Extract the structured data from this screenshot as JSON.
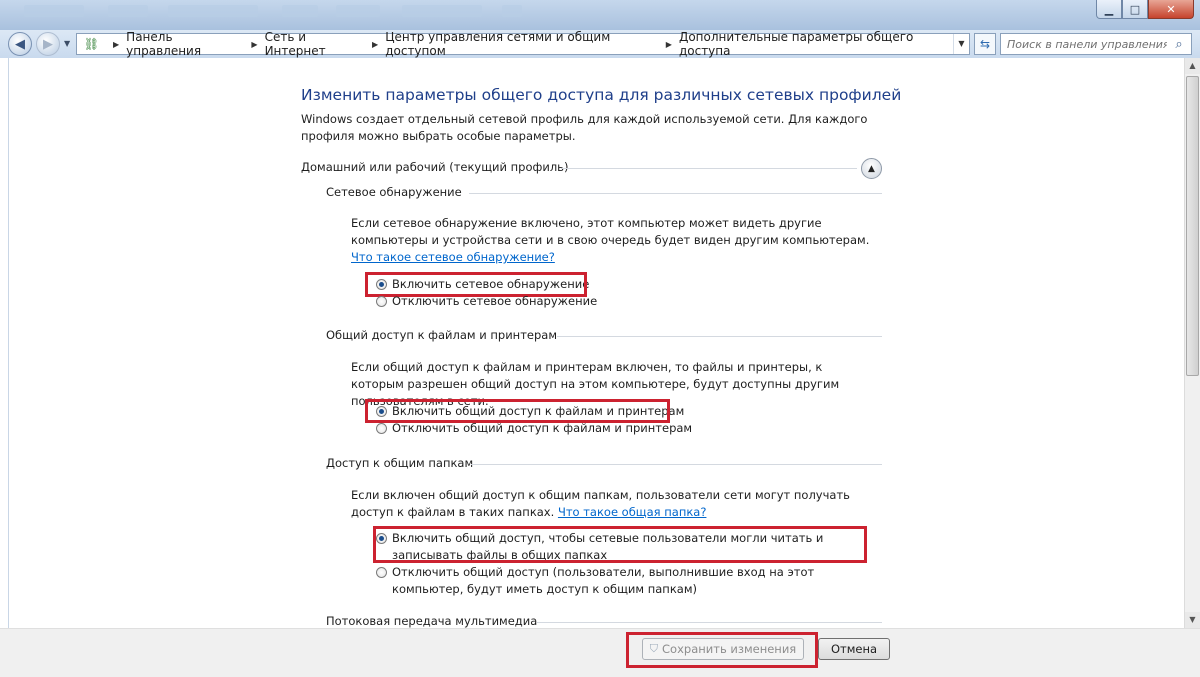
{
  "address_bar": {
    "breadcrumbs": [
      "Панель управления",
      "Сеть и Интернет",
      "Центр управления сетями и общим доступом",
      "Дополнительные параметры общего доступа"
    ],
    "search_placeholder": "Поиск в панели управления"
  },
  "main": {
    "title": "Изменить параметры общего доступа для различных сетевых профилей",
    "intro": "Windows создает отдельный сетевой профиль для каждой используемой сети. Для каждого профиля можно выбрать особые параметры.",
    "profile_header": "Домашний или рабочий (текущий профиль)",
    "sections": [
      {
        "title": "Сетевое обнаружение",
        "description": "Если сетевое обнаружение включено, этот компьютер может видеть другие компьютеры и устройства сети и в свою очередь будет виден другим компьютерам.",
        "link": "Что такое сетевое обнаружение?",
        "options": [
          {
            "label": "Включить сетевое обнаружение",
            "selected": true
          },
          {
            "label": "Отключить сетевое обнаружение",
            "selected": false
          }
        ]
      },
      {
        "title": "Общий доступ к файлам и принтерам",
        "description": "Если общий доступ к файлам и принтерам включен, то файлы и принтеры, к которым разрешен общий доступ на этом компьютере, будут доступны другим пользователям в сети.",
        "options": [
          {
            "label": "Включить общий доступ к файлам и принтерам",
            "selected": true
          },
          {
            "label": "Отключить общий доступ к файлам и принтерам",
            "selected": false
          }
        ]
      },
      {
        "title": "Доступ к общим папкам",
        "description": "Если включен общий доступ к общим папкам, пользователи сети могут получать доступ к файлам в таких папках.",
        "link": "Что такое общая папка?",
        "options": [
          {
            "label": "Включить общий доступ, чтобы сетевые пользователи могли читать и записывать файлы в общих папках",
            "selected": true
          },
          {
            "label": "Отключить общий доступ (пользователи, выполнившие вход на этот компьютер, будут иметь доступ к общим папкам)",
            "selected": false
          }
        ]
      },
      {
        "title": "Потоковая передача мультимедиа"
      }
    ]
  },
  "buttons": {
    "save": "Сохранить изменения",
    "cancel": "Отмена"
  },
  "highlight_color": "#cc2230"
}
